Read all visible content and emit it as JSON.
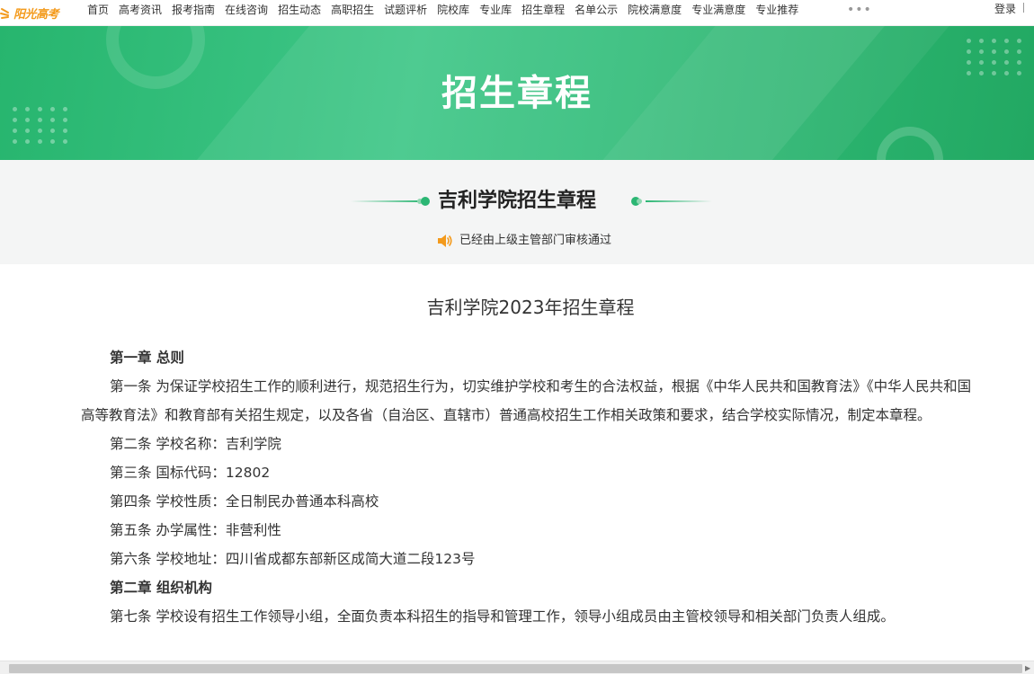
{
  "nav": {
    "logo_text": "阳光高考",
    "items": [
      "首页",
      "高考资讯",
      "报考指南",
      "在线咨询",
      "招生动态",
      "高职招生",
      "试题评析",
      "院校库",
      "专业库",
      "招生章程",
      "名单公示",
      "院校满意度",
      "专业满意度",
      "专业推荐"
    ],
    "more_label": "•••",
    "login_label": "登录"
  },
  "banner": {
    "title": "招生章程"
  },
  "header": {
    "school_title": "吉利学院招生章程",
    "notice_text": "已经由上级主管部门审核通过"
  },
  "document": {
    "title": "吉利学院2023年招生章程",
    "paragraphs": [
      {
        "text": "第一章 总则",
        "bold": true
      },
      {
        "text": "第一条 为保证学校招生工作的顺利进行，规范招生行为，切实维护学校和考生的合法权益，根据《中华人民共和国教育法》《中华人民共和国高等教育法》和教育部有关招生规定，以及各省（自治区、直辖市）普通高校招生工作相关政策和要求，结合学校实际情况，制定本章程。",
        "bold": false
      },
      {
        "text": "第二条 学校名称：吉利学院",
        "bold": false
      },
      {
        "text": "第三条 国标代码：12802",
        "bold": false
      },
      {
        "text": "第四条 学校性质：全日制民办普通本科高校",
        "bold": false
      },
      {
        "text": "第五条 办学属性：非营利性",
        "bold": false
      },
      {
        "text": "第六条 学校地址：四川省成都东部新区成简大道二段123号",
        "bold": false
      },
      {
        "text": "第二章 组织机构",
        "bold": true
      },
      {
        "text": "第七条 学校设有招生工作领导小组，全面负责本科招生的指导和管理工作，领导小组成员由主管校领导和相关部门负责人组成。",
        "bold": false
      }
    ]
  },
  "colors": {
    "brand_green": "#2bb673",
    "logo_orange": "#f39a1c"
  }
}
